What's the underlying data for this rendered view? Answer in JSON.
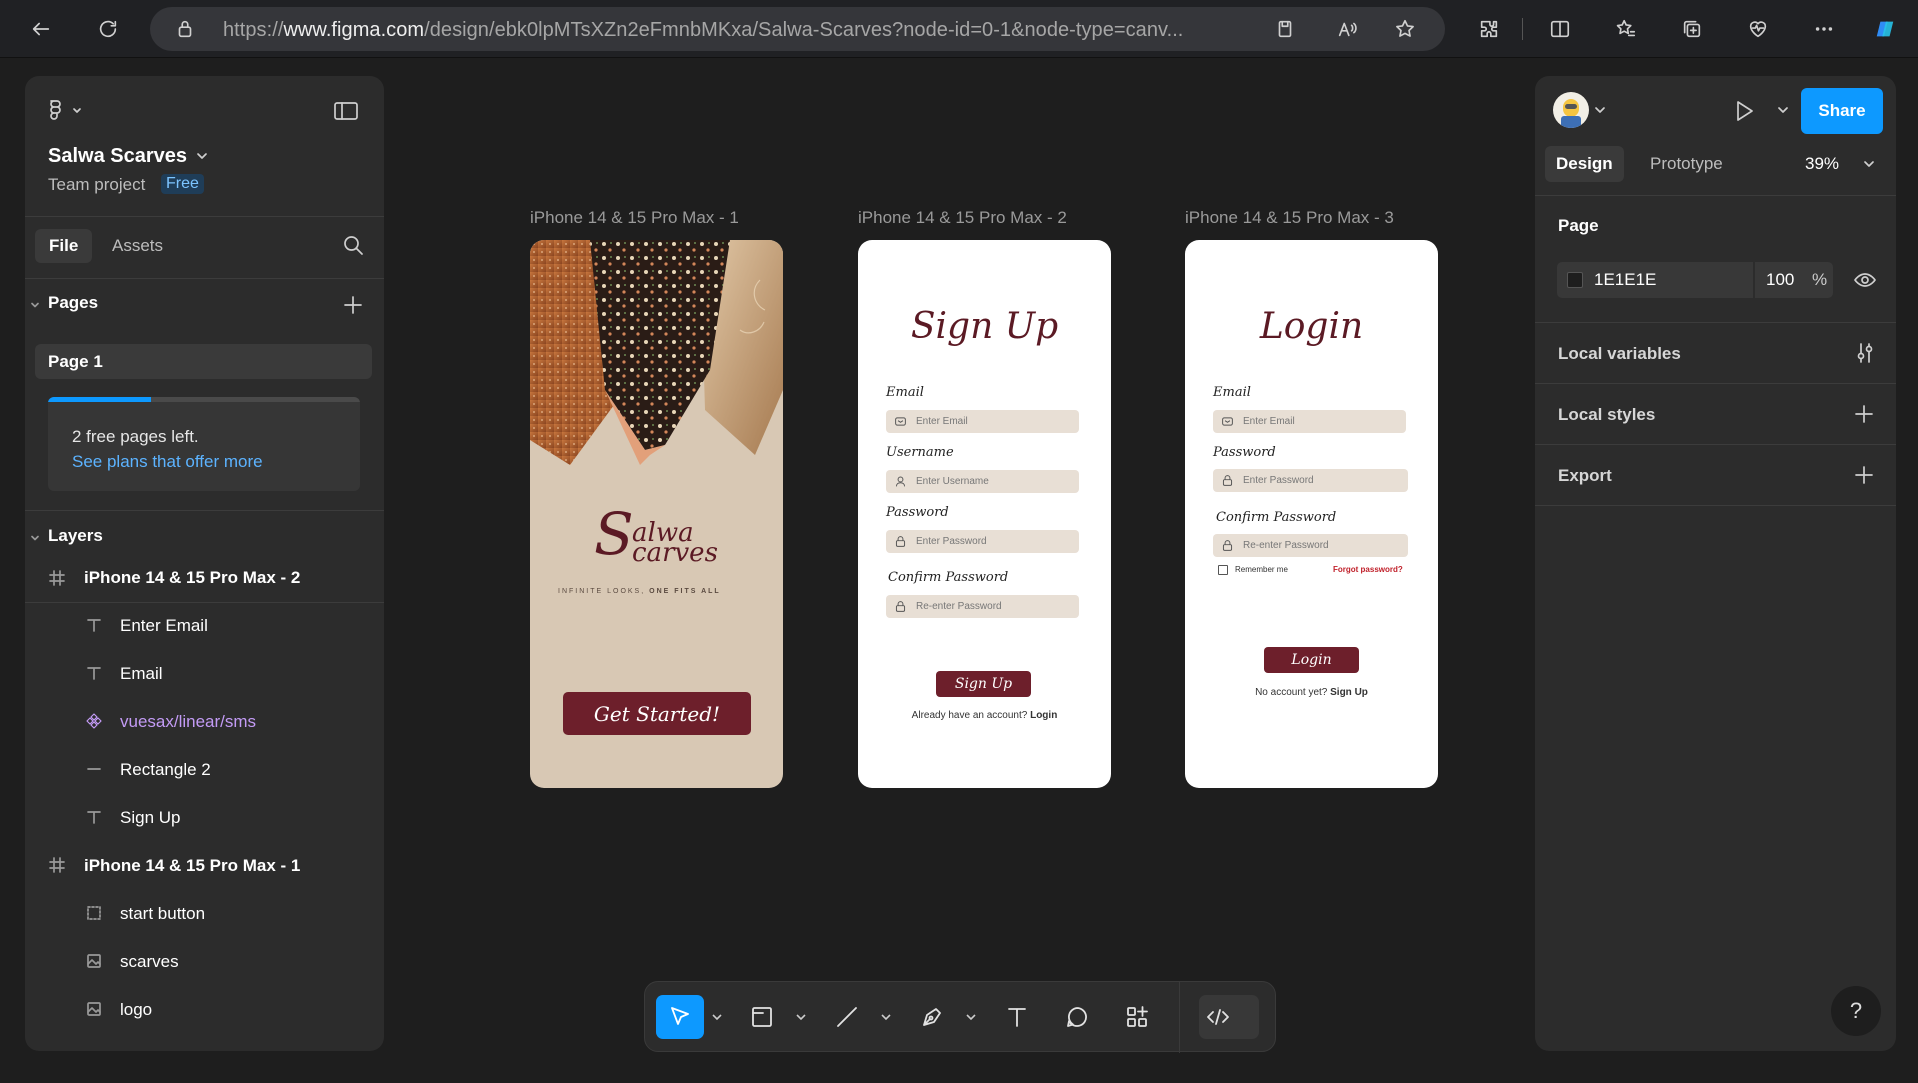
{
  "browser": {
    "url_prefix": "https://",
    "url_domain": "www.figma.com",
    "url_path": "/design/ebk0lpMTsXZn2eFmnbMKxa/Salwa-Scarves?node-id=0-1&node-type=canv..."
  },
  "file": {
    "name": "Salwa Scarves",
    "team": "Team project",
    "plan_badge": "Free"
  },
  "left_tabs": {
    "file": "File",
    "assets": "Assets"
  },
  "pages": {
    "heading": "Pages",
    "items": [
      "Page 1"
    ],
    "notice_line1": "2 free pages left.",
    "notice_link": "See plans that offer more",
    "usage_fraction": 0.33
  },
  "layers": {
    "heading": "Layers",
    "items": [
      {
        "name": "iPhone 14 & 15 Pro Max - 2",
        "kind": "frame"
      },
      {
        "name": "Enter Email",
        "kind": "text"
      },
      {
        "name": "Email",
        "kind": "text"
      },
      {
        "name": "vuesax/linear/sms",
        "kind": "component"
      },
      {
        "name": "Rectangle 2",
        "kind": "line"
      },
      {
        "name": "Sign Up",
        "kind": "text"
      },
      {
        "name": "iPhone 14 & 15 Pro Max - 1",
        "kind": "frame"
      },
      {
        "name": "start button",
        "kind": "group"
      },
      {
        "name": "scarves",
        "kind": "image"
      },
      {
        "name": "logo",
        "kind": "image"
      }
    ]
  },
  "canvas": {
    "frames": [
      {
        "label": "iPhone 14 & 15 Pro Max - 1"
      },
      {
        "label": "iPhone 14 & 15 Pro Max - 2"
      },
      {
        "label": "iPhone 14 & 15 Pro Max - 3"
      }
    ],
    "splash": {
      "logo_line1": "alwa",
      "logo_line2": "carves",
      "logo_initial": "S",
      "tagline_a": "INFINITE LOOKS,",
      "tagline_b": "ONE FITS ALL",
      "button": "Get Started!"
    },
    "signup": {
      "title": "Sign Up",
      "email_label": "Email",
      "email_placeholder": "Enter Email",
      "username_label": "Username",
      "username_placeholder": "Enter Username",
      "password_label": "Password",
      "password_placeholder": "Enter Password",
      "confirm_label": "Confirm Password",
      "confirm_placeholder": "Re-enter Password",
      "button": "Sign Up",
      "footer_text": "Already have an account?",
      "footer_link": "Login"
    },
    "login": {
      "title": "Login",
      "email_label": "Email",
      "email_placeholder": "Enter Email",
      "password_label": "Password",
      "password_placeholder": "Enter Password",
      "confirm_label": "Confirm Password",
      "confirm_placeholder": "Re-enter Password",
      "remember": "Remember me",
      "forgot": "Forgot password?",
      "button": "Login",
      "footer_text": "No account yet?",
      "footer_link": "Sign Up"
    }
  },
  "right_panel": {
    "share": "Share",
    "tabs": {
      "design": "Design",
      "prototype": "Prototype"
    },
    "zoom": "39%",
    "page_heading": "Page",
    "bg_color_hex": "1E1E1E",
    "bg_opacity": "100",
    "percent": "%",
    "local_variables": "Local variables",
    "local_styles": "Local styles",
    "export": "Export"
  },
  "help": "?",
  "colors": {
    "accent": "#0d99ff",
    "brand_maroon": "#6d1f2b",
    "canvas_bg": "#1e1e1e",
    "splash_bg": "#d8c8b4",
    "input_bg": "#e8dfd5",
    "component_purple": "#c39bf5"
  }
}
